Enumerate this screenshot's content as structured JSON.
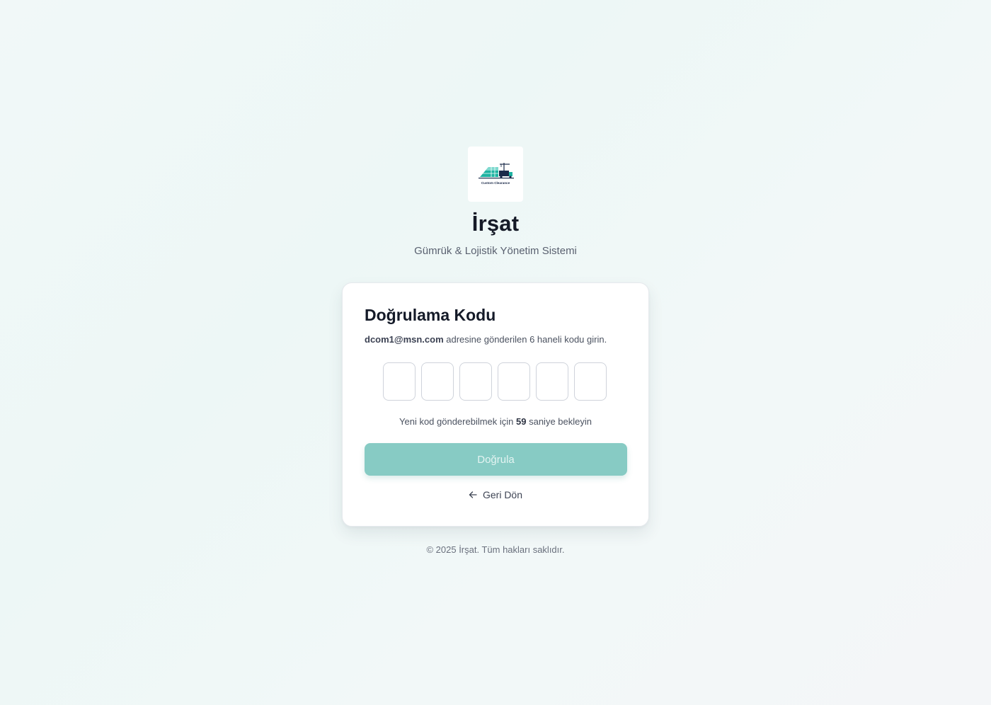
{
  "brand": {
    "logo_caption": "Custom Clearance",
    "title": "İrşat",
    "subtitle": "Gümrük & Lojistik Yönetim Sistemi",
    "accent_color": "#1aa89a"
  },
  "verification": {
    "title": "Doğrulama Kodu",
    "email": "dcom1@msn.com",
    "description_suffix": " adresine gönderilen 6 haneli kodu girin.",
    "code_digits": [
      "",
      "",
      "",
      "",
      "",
      ""
    ],
    "resend_prefix": "Yeni kod gönderebilmek için ",
    "resend_seconds": "59",
    "resend_suffix": " saniye bekleyin",
    "verify_button": "Doğrula",
    "verify_button_color": "#87cbc4",
    "verify_button_disabled": true,
    "back_label": "Geri Dön",
    "back_icon": "arrow-left-icon"
  },
  "footer": {
    "copyright": "© 2025 İrşat. Tüm hakları saklıdır."
  }
}
